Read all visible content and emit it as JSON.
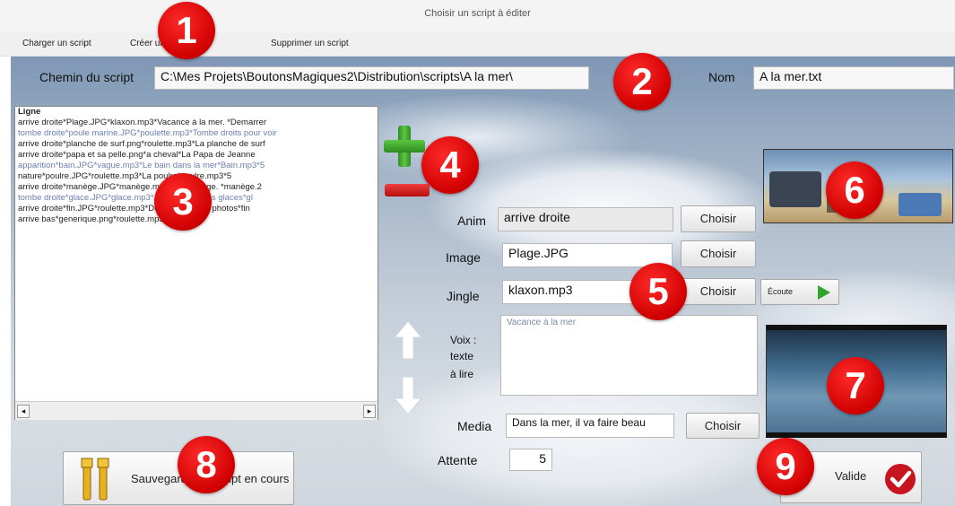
{
  "window": {
    "title": "Choisir un script à éditer"
  },
  "menu": {
    "items": [
      {
        "label": "Charger un script"
      },
      {
        "label": "Créer un script"
      },
      {
        "label": "Supprimer un script"
      }
    ]
  },
  "path": {
    "label": "Chemin du script",
    "value": "C:\\Mes Projets\\BoutonsMagiques2\\Distribution\\scripts\\A la mer\\"
  },
  "name": {
    "label": "Nom",
    "value": "A la mer.txt"
  },
  "script": {
    "header": "Ligne",
    "lines": [
      "arrive droite*Plage.JPG*klaxon.mp3*Vacance à la mer. *Demarrer",
      "tombe droite*poule marine.JPG*poulette.mp3*Tombe droits pour voir",
      "arrive droite*planche de surf.png*roulette.mp3*La planche de surf",
      "arrive droite*papa et sa pelle.png*a cheval*La Papa de Jeanne",
      "apparition*bain.JPG*vague.mp3*Le bain dans la mer*Bain.mp3*5",
      "nature*poulre.JPG*roulette.mp3*La poulre*poulre.mp3*5",
      "arrive droite*manège.JPG*manège.mp3*Au manège. *manège.2",
      "tombe droite*glace.JPG*glace.mp3*Jeanne aime les glaces*gl",
      "arrive droite*fin.JPG*roulette.mp3*Du fun de belles photos*fin",
      "arrive bas*generique.png*roulette.mp3****5"
    ]
  },
  "form": {
    "anim_label": "Anim",
    "anim_value": "arrive droite",
    "anim_button": "Choisir",
    "image_label": "Image",
    "image_value": "Plage.JPG",
    "image_button": "Choisir",
    "jingle_label": "Jingle",
    "jingle_value": "klaxon.mp3",
    "jingle_button": "Choisir",
    "ecoute_label": "Écoute",
    "voice_label_1": "Voix :",
    "voice_label_2": "texte",
    "voice_label_3": "à lire",
    "voice_text": "Vacance à la mer",
    "media_label": "Media",
    "media_value": "Dans la mer, il va faire beau",
    "media_button": "Choisir",
    "wait_label": "Attente",
    "wait_value": "5"
  },
  "save": {
    "label": "Sauvegarder le script en cours"
  },
  "validate": {
    "label": "Valide"
  },
  "callouts": [
    "1",
    "2",
    "3",
    "4",
    "5",
    "6",
    "7",
    "8",
    "9"
  ],
  "icons": {
    "add": "plus-icon",
    "remove": "minus-icon",
    "up": "arrow-up-icon",
    "down": "arrow-down-icon",
    "play": "play-icon",
    "tools": "tools-icon",
    "check": "check-icon"
  },
  "colors": {
    "callout": "#d40000",
    "add": "#3fa52b",
    "remove": "#d61818",
    "play": "#2fa52b"
  }
}
